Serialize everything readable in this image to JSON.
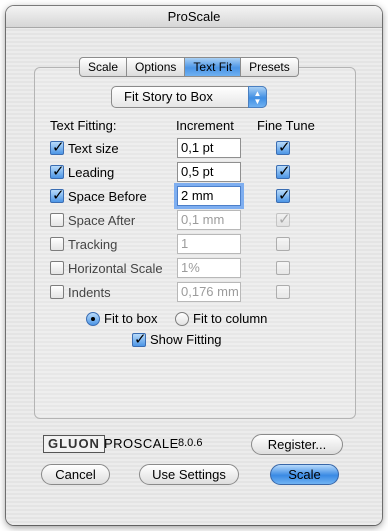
{
  "window": {
    "title": "ProScale"
  },
  "tabs": [
    {
      "label": "Scale",
      "active": false
    },
    {
      "label": "Options",
      "active": false
    },
    {
      "label": "Text Fit",
      "active": true
    },
    {
      "label": "Presets",
      "active": false
    }
  ],
  "popup": {
    "value": "Fit Story to Box"
  },
  "headers": {
    "text_fitting": "Text Fitting:",
    "increment": "Increment",
    "fine_tune": "Fine Tune"
  },
  "rows": [
    {
      "label": "Text size",
      "enabled": true,
      "increment": "0,1 pt",
      "fine_tune": true
    },
    {
      "label": "Leading",
      "enabled": true,
      "increment": "0,5 pt",
      "fine_tune": true
    },
    {
      "label": "Space Before",
      "enabled": true,
      "increment": "2 mm",
      "fine_tune": true
    },
    {
      "label": "Space After",
      "enabled": false,
      "increment": "0,1 mm",
      "fine_tune": true
    },
    {
      "label": "Tracking",
      "enabled": false,
      "increment": "1",
      "fine_tune": false
    },
    {
      "label": "Horizontal Scale",
      "enabled": false,
      "increment": "1%",
      "fine_tune": false
    },
    {
      "label": "Indents",
      "enabled": false,
      "increment": "0,176 mm",
      "fine_tune": false
    }
  ],
  "fit_mode": {
    "fit_to_box": "Fit to box",
    "fit_to_column": "Fit to column",
    "selected": "fit_to_box"
  },
  "show_fitting": {
    "label": "Show Fitting",
    "checked": true
  },
  "brand": {
    "gluon": "GLUON",
    "proscale": "PROSCALE",
    "version": "8.0.6"
  },
  "buttons": {
    "register": "Register...",
    "cancel": "Cancel",
    "use_settings": "Use Settings",
    "scale": "Scale"
  },
  "colors": {
    "accent": "#4b95e6"
  }
}
